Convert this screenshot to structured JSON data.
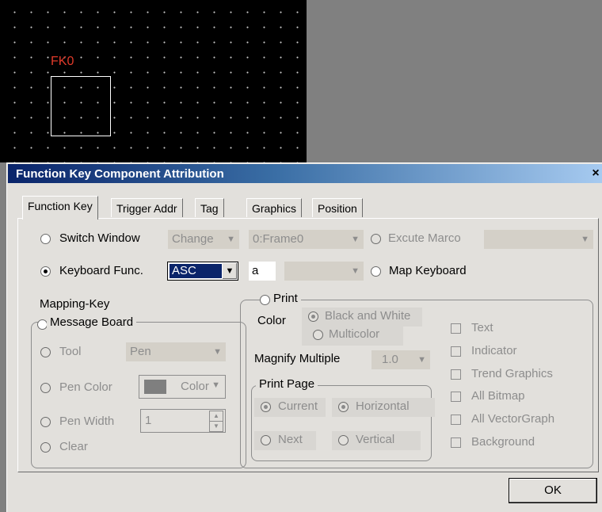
{
  "canvas": {
    "label": "FK0"
  },
  "dialog": {
    "title": "Function Key Component Attribution",
    "close": "×",
    "tabs": [
      "Function Key",
      "Trigger Addr",
      "Tag",
      "Graphics",
      "Position"
    ],
    "active_tab": "Function Key",
    "switch_window": {
      "label": "Switch Window",
      "selected": false,
      "mode": "Change",
      "frame": "0:Frame0"
    },
    "excute_marco": {
      "label": "Excute Marco",
      "selected": false,
      "value": ""
    },
    "keyboard_func": {
      "label": "Keyboard Func.",
      "selected": true,
      "mode": "ASC",
      "char": "a",
      "extra": ""
    },
    "map_keyboard": {
      "label": "Map Keyboard",
      "selected": false
    },
    "mapping_key": "Mapping-Key",
    "message_board": {
      "label": "Message Board",
      "tool_label": "Tool",
      "tool_value": "Pen",
      "pen_color_label": "Pen Color",
      "pen_color_value": "Color",
      "pen_color_swatch": "#7f7f7f",
      "pen_width_label": "Pen Width",
      "pen_width_value": "1",
      "clear_label": "Clear"
    },
    "print": {
      "label": "Print",
      "color_label": "Color",
      "bw_label": "Black and White",
      "multicolor_label": "Multicolor",
      "magnify_label": "Magnify Multiple",
      "magnify_value": "1.0",
      "page_label": "Print Page",
      "current": "Current",
      "horizontal": "Horizontal",
      "next": "Next",
      "vertical": "Vertical",
      "options": [
        "Text",
        "Indicator",
        "Trend Graphics",
        "All Bitmap",
        "All VectorGraph",
        "Background"
      ]
    },
    "ok": "OK"
  },
  "colors": {
    "title_start": "#0a246a",
    "title_end": "#a6caf0",
    "canvas_label": "#e03a2a",
    "selection": "#0a246a"
  }
}
